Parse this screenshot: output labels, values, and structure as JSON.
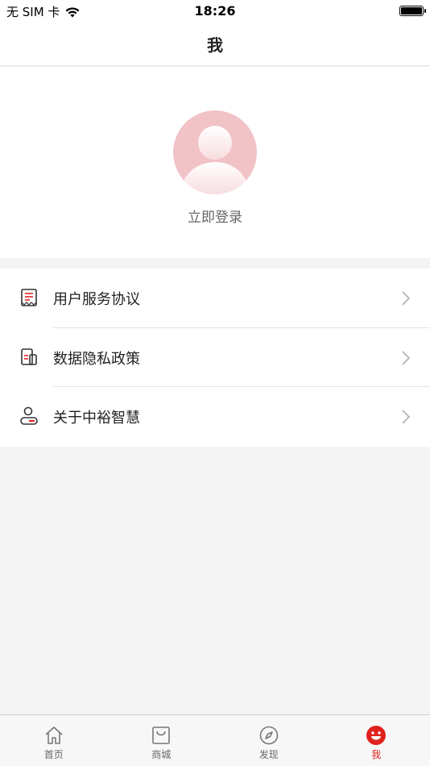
{
  "status_bar": {
    "carrier": "无 SIM 卡",
    "time": "18:26"
  },
  "nav": {
    "title": "我"
  },
  "profile": {
    "login_label": "立即登录"
  },
  "menu": [
    {
      "label": "用户服务协议",
      "icon": "document-list-icon"
    },
    {
      "label": "数据隐私政策",
      "icon": "privacy-doc-icon"
    },
    {
      "label": "关于中裕智慧",
      "icon": "person-info-icon"
    }
  ],
  "tabs": [
    {
      "label": "首页",
      "icon": "home-icon",
      "active": false
    },
    {
      "label": "商城",
      "icon": "shopping-bag-icon",
      "active": false
    },
    {
      "label": "发现",
      "icon": "compass-icon",
      "active": false
    },
    {
      "label": "我",
      "icon": "smiley-icon",
      "active": true
    }
  ],
  "colors": {
    "accent": "#e0221f",
    "avatar_bg": "#f1c2c6",
    "page_bg": "#f4f4f4"
  }
}
